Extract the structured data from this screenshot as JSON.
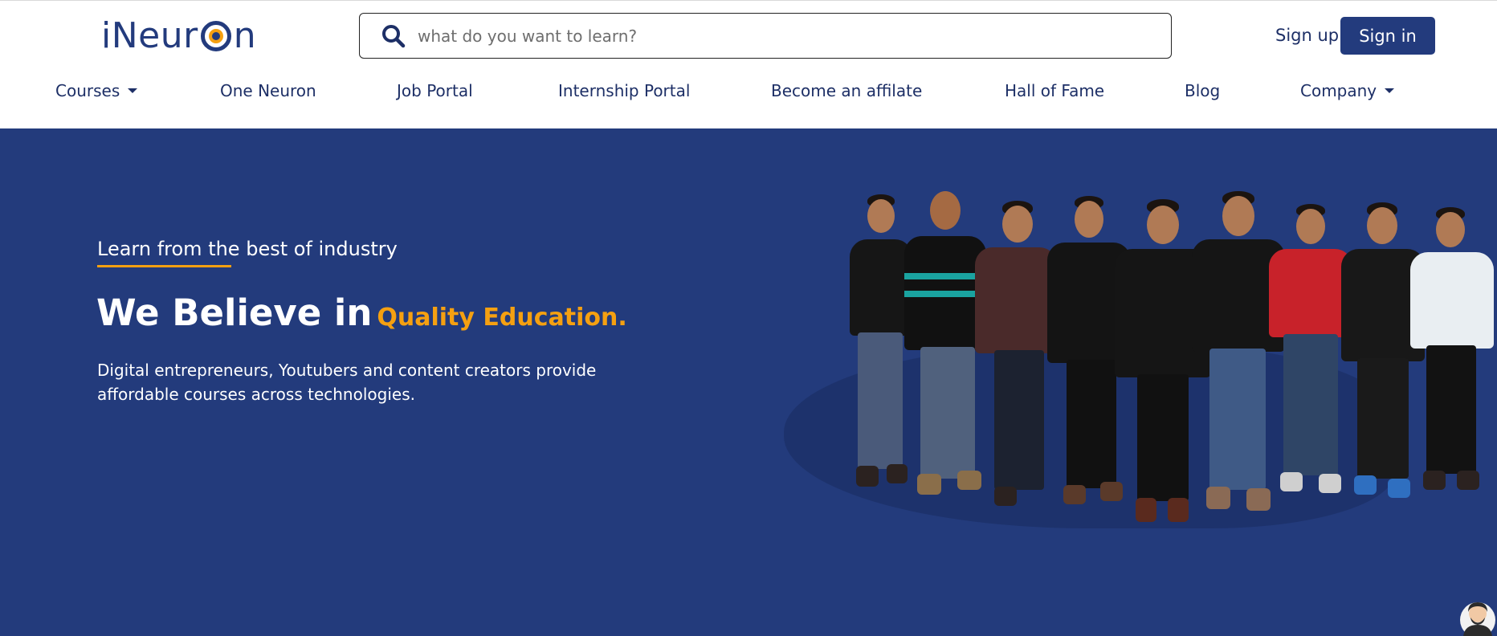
{
  "header": {
    "logo": {
      "prefix": "iNeur",
      "suffix": "n"
    },
    "search": {
      "placeholder": "what do you want to learn?"
    },
    "signup_label": "Sign up",
    "signin_label": "Sign in"
  },
  "nav": {
    "items": [
      {
        "label": "Courses",
        "has_dropdown": true
      },
      {
        "label": "One Neuron",
        "has_dropdown": false
      },
      {
        "label": "Job Portal",
        "has_dropdown": false
      },
      {
        "label": "Internship Portal",
        "has_dropdown": false
      },
      {
        "label": "Become an affilate",
        "has_dropdown": false
      },
      {
        "label": "Hall of Fame",
        "has_dropdown": false
      },
      {
        "label": "Blog",
        "has_dropdown": false
      },
      {
        "label": "Company",
        "has_dropdown": true
      }
    ]
  },
  "hero": {
    "tagline": "Learn from the best of industry",
    "headline_main": "We Believe in",
    "headline_accent": "Quality Education.",
    "description": "Digital entrepreneurs, Youtubers and content creators provide affordable courses across technologies.",
    "image_alt": "team photo"
  },
  "colors": {
    "brand_blue": "#233b7d",
    "accent_orange": "#f5a011",
    "hero_bg": "#233b7c",
    "nav_text": "#1d2f66"
  },
  "icons": {
    "search": "search-icon",
    "logo_mark": "neuron-ring-icon",
    "dropdown": "caret-down-icon",
    "chat_avatar": "chat-avatar-icon"
  }
}
